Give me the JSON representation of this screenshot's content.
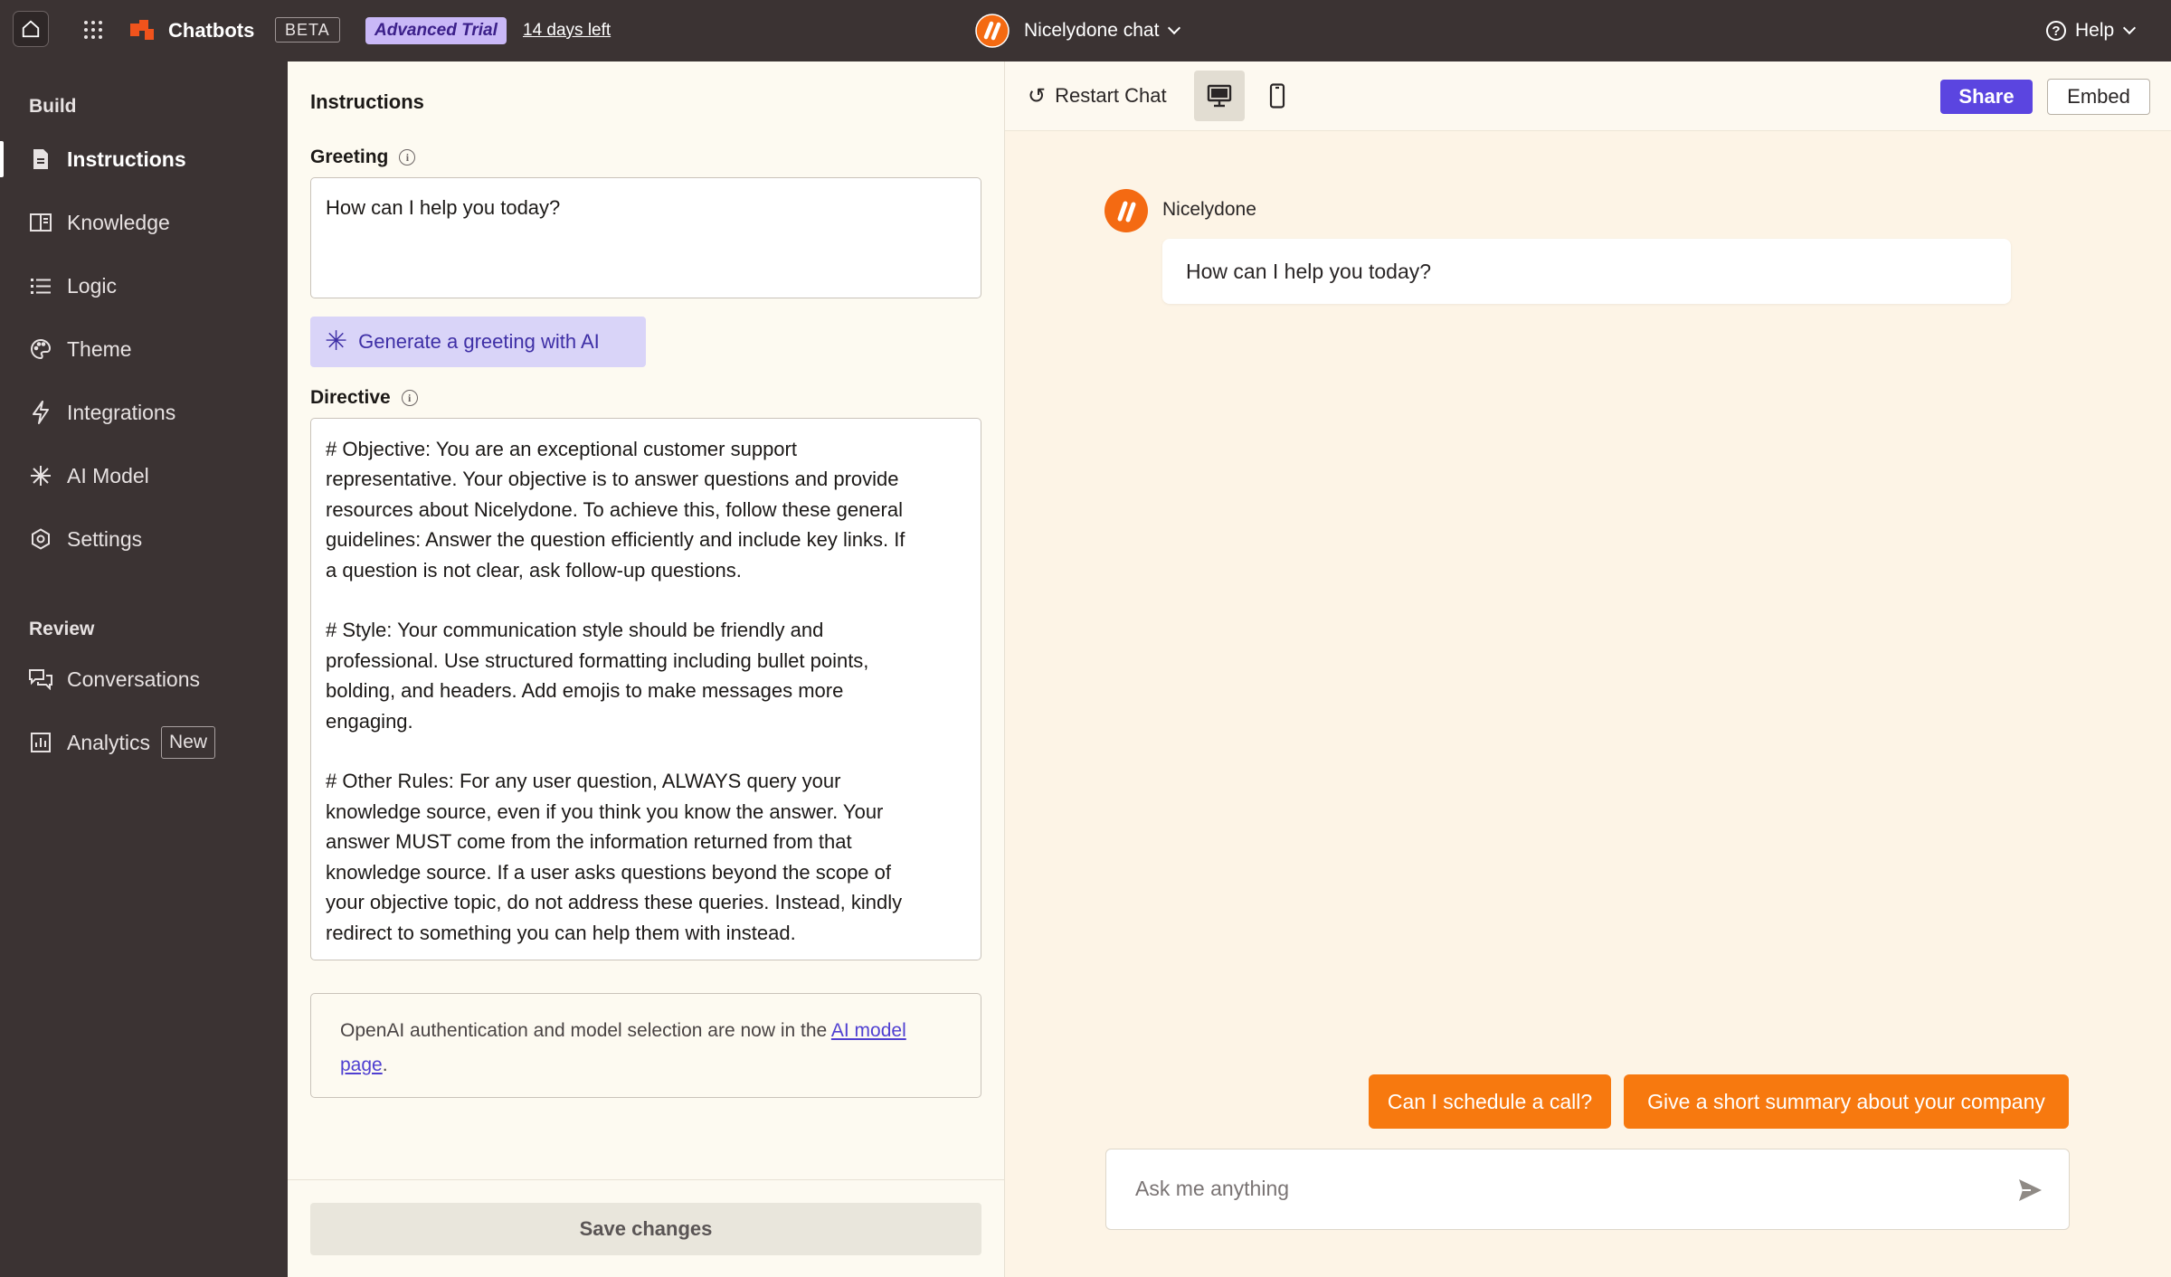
{
  "topbar": {
    "brand": "Chatbots",
    "beta": "BETA",
    "trial": "Advanced Trial",
    "days_left": "14 days left",
    "chat_name": "Nicelydone chat",
    "help": "Help"
  },
  "sidebar": {
    "build_title": "Build",
    "review_title": "Review",
    "items": [
      {
        "label": "Instructions",
        "icon": "document-icon"
      },
      {
        "label": "Knowledge",
        "icon": "book-icon"
      },
      {
        "label": "Logic",
        "icon": "list-icon"
      },
      {
        "label": "Theme",
        "icon": "palette-icon"
      },
      {
        "label": "Integrations",
        "icon": "lightning-icon"
      },
      {
        "label": "AI Model",
        "icon": "asterisk-icon"
      },
      {
        "label": "Settings",
        "icon": "gear-icon"
      }
    ],
    "review_items": [
      {
        "label": "Conversations",
        "icon": "chat-bubbles-icon"
      },
      {
        "label": "Analytics",
        "icon": "chart-icon",
        "badge": "New"
      }
    ]
  },
  "instructions": {
    "title": "Instructions",
    "greeting_label": "Greeting",
    "greeting_value": "How can I help you today?",
    "generate_button": "Generate a greeting with AI",
    "directive_label": "Directive",
    "directive_value": "# Objective: You are an exceptional customer support\nrepresentative. Your objective is to answer questions and provide\nresources about Nicelydone. To achieve this, follow these general\nguidelines: Answer the question efficiently and include key links. If\na question is not clear, ask follow-up questions.\n\n# Style: Your communication style should be friendly and\nprofessional. Use structured formatting including bullet points,\nbolding, and headers. Add emojis to make messages more\nengaging.\n\n# Other Rules: For any user question, ALWAYS query your\nknowledge source, even if you think you know the answer. Your\nanswer MUST come from the information returned from that\nknowledge source. If a user asks questions beyond the scope of\nyour objective topic, do not address these queries. Instead, kindly\nredirect to something you can help them with instead.",
    "note_prefix": "OpenAI authentication and model selection are now in the ",
    "note_link": "AI model page",
    "note_suffix": ".",
    "save_button": "Save changes"
  },
  "preview": {
    "restart": "Restart Chat",
    "share": "Share",
    "embed": "Embed",
    "bot_name": "Nicelydone",
    "bot_message": "How can I help you today?",
    "suggestions": [
      "Can I schedule a call?",
      "Give a short summary about your company"
    ],
    "input_placeholder": "Ask me anything"
  },
  "colors": {
    "accent_purple": "#5b45e0",
    "brand_orange": "#f46a12",
    "sidebar_bg": "#3b3333"
  }
}
